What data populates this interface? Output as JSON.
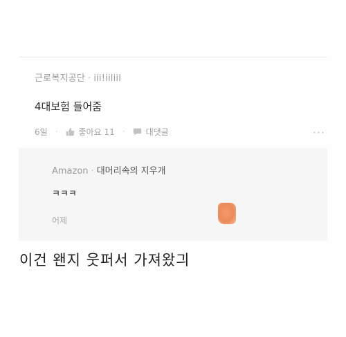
{
  "comment": {
    "author": "근로복지공단",
    "author_badge": "iii!iiliil",
    "separator": "·",
    "body": "4대보험 들어줌",
    "time": "6일",
    "like_label": "좋아요 11",
    "reply_label": "대댓글",
    "more_label": "···"
  },
  "reply": {
    "author": "Amazon",
    "separator": "·",
    "mention": "대머리속의 지우개",
    "body": "ㅋㅋㅋ",
    "time": "어제"
  },
  "caption": "이건 왠지 웃퍼서 가져왔긔",
  "colors": {
    "reply_background": "#f6f6f6",
    "thumbnail_orange": "#ea8a5a"
  },
  "icons": {
    "like": "thumbs-up-icon",
    "reply": "speech-bubble-icon",
    "more": "more-dots-icon"
  }
}
